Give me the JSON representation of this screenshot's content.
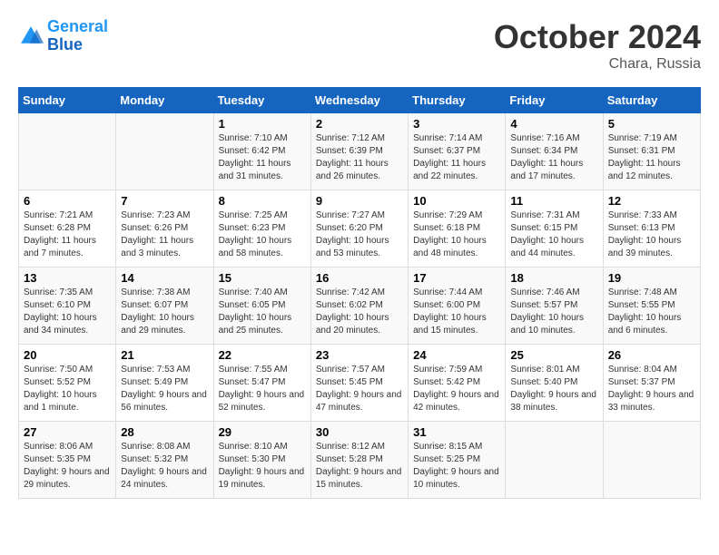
{
  "header": {
    "logo_line1": "General",
    "logo_line2": "Blue",
    "month": "October 2024",
    "location": "Chara, Russia"
  },
  "days_of_week": [
    "Sunday",
    "Monday",
    "Tuesday",
    "Wednesday",
    "Thursday",
    "Friday",
    "Saturday"
  ],
  "weeks": [
    [
      {
        "day": "",
        "info": ""
      },
      {
        "day": "",
        "info": ""
      },
      {
        "day": "1",
        "info": "Sunrise: 7:10 AM\nSunset: 6:42 PM\nDaylight: 11 hours and 31 minutes."
      },
      {
        "day": "2",
        "info": "Sunrise: 7:12 AM\nSunset: 6:39 PM\nDaylight: 11 hours and 26 minutes."
      },
      {
        "day": "3",
        "info": "Sunrise: 7:14 AM\nSunset: 6:37 PM\nDaylight: 11 hours and 22 minutes."
      },
      {
        "day": "4",
        "info": "Sunrise: 7:16 AM\nSunset: 6:34 PM\nDaylight: 11 hours and 17 minutes."
      },
      {
        "day": "5",
        "info": "Sunrise: 7:19 AM\nSunset: 6:31 PM\nDaylight: 11 hours and 12 minutes."
      }
    ],
    [
      {
        "day": "6",
        "info": "Sunrise: 7:21 AM\nSunset: 6:28 PM\nDaylight: 11 hours and 7 minutes."
      },
      {
        "day": "7",
        "info": "Sunrise: 7:23 AM\nSunset: 6:26 PM\nDaylight: 11 hours and 3 minutes."
      },
      {
        "day": "8",
        "info": "Sunrise: 7:25 AM\nSunset: 6:23 PM\nDaylight: 10 hours and 58 minutes."
      },
      {
        "day": "9",
        "info": "Sunrise: 7:27 AM\nSunset: 6:20 PM\nDaylight: 10 hours and 53 minutes."
      },
      {
        "day": "10",
        "info": "Sunrise: 7:29 AM\nSunset: 6:18 PM\nDaylight: 10 hours and 48 minutes."
      },
      {
        "day": "11",
        "info": "Sunrise: 7:31 AM\nSunset: 6:15 PM\nDaylight: 10 hours and 44 minutes."
      },
      {
        "day": "12",
        "info": "Sunrise: 7:33 AM\nSunset: 6:13 PM\nDaylight: 10 hours and 39 minutes."
      }
    ],
    [
      {
        "day": "13",
        "info": "Sunrise: 7:35 AM\nSunset: 6:10 PM\nDaylight: 10 hours and 34 minutes."
      },
      {
        "day": "14",
        "info": "Sunrise: 7:38 AM\nSunset: 6:07 PM\nDaylight: 10 hours and 29 minutes."
      },
      {
        "day": "15",
        "info": "Sunrise: 7:40 AM\nSunset: 6:05 PM\nDaylight: 10 hours and 25 minutes."
      },
      {
        "day": "16",
        "info": "Sunrise: 7:42 AM\nSunset: 6:02 PM\nDaylight: 10 hours and 20 minutes."
      },
      {
        "day": "17",
        "info": "Sunrise: 7:44 AM\nSunset: 6:00 PM\nDaylight: 10 hours and 15 minutes."
      },
      {
        "day": "18",
        "info": "Sunrise: 7:46 AM\nSunset: 5:57 PM\nDaylight: 10 hours and 10 minutes."
      },
      {
        "day": "19",
        "info": "Sunrise: 7:48 AM\nSunset: 5:55 PM\nDaylight: 10 hours and 6 minutes."
      }
    ],
    [
      {
        "day": "20",
        "info": "Sunrise: 7:50 AM\nSunset: 5:52 PM\nDaylight: 10 hours and 1 minute."
      },
      {
        "day": "21",
        "info": "Sunrise: 7:53 AM\nSunset: 5:49 PM\nDaylight: 9 hours and 56 minutes."
      },
      {
        "day": "22",
        "info": "Sunrise: 7:55 AM\nSunset: 5:47 PM\nDaylight: 9 hours and 52 minutes."
      },
      {
        "day": "23",
        "info": "Sunrise: 7:57 AM\nSunset: 5:45 PM\nDaylight: 9 hours and 47 minutes."
      },
      {
        "day": "24",
        "info": "Sunrise: 7:59 AM\nSunset: 5:42 PM\nDaylight: 9 hours and 42 minutes."
      },
      {
        "day": "25",
        "info": "Sunrise: 8:01 AM\nSunset: 5:40 PM\nDaylight: 9 hours and 38 minutes."
      },
      {
        "day": "26",
        "info": "Sunrise: 8:04 AM\nSunset: 5:37 PM\nDaylight: 9 hours and 33 minutes."
      }
    ],
    [
      {
        "day": "27",
        "info": "Sunrise: 8:06 AM\nSunset: 5:35 PM\nDaylight: 9 hours and 29 minutes."
      },
      {
        "day": "28",
        "info": "Sunrise: 8:08 AM\nSunset: 5:32 PM\nDaylight: 9 hours and 24 minutes."
      },
      {
        "day": "29",
        "info": "Sunrise: 8:10 AM\nSunset: 5:30 PM\nDaylight: 9 hours and 19 minutes."
      },
      {
        "day": "30",
        "info": "Sunrise: 8:12 AM\nSunset: 5:28 PM\nDaylight: 9 hours and 15 minutes."
      },
      {
        "day": "31",
        "info": "Sunrise: 8:15 AM\nSunset: 5:25 PM\nDaylight: 9 hours and 10 minutes."
      },
      {
        "day": "",
        "info": ""
      },
      {
        "day": "",
        "info": ""
      }
    ]
  ]
}
